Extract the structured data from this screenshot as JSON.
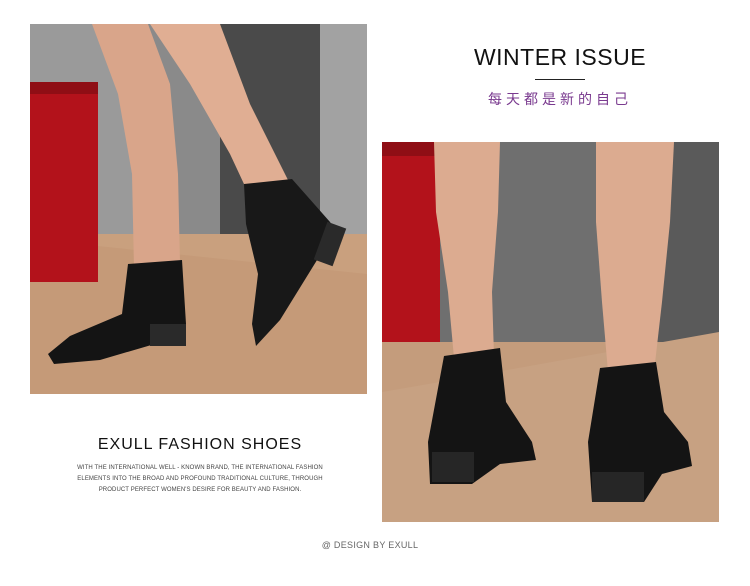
{
  "colors": {
    "accent_purple": "#7a3a8f",
    "wall_gray": "#6b6b6b",
    "floor_tan": "#c9a07e",
    "red_box": "#b3121b",
    "boot_black": "#141414"
  },
  "header": {
    "title": "WINTER ISSUE",
    "subtitle": "每天都是新的自己"
  },
  "brand": {
    "title": "EXULL  FASHION  SHOES",
    "desc_lines": [
      "WITH THE INTERNATIONAL WELL - KNOWN BRAND, THE INTERNATIONAL FASHION",
      "ELEMENTS INTO THE BROAD AND PROFOUND TRADITIONAL CULTURE, THROUGH",
      "PRODUCT PERFECT WOMEN'S DESIRE FOR BEAUTY AND FASHION."
    ]
  },
  "footer": {
    "credit": "@ DESIGN BY EXULL"
  },
  "photos": {
    "left_alt": "photo-side-view-boots",
    "right_alt": "photo-back-view-boots"
  }
}
